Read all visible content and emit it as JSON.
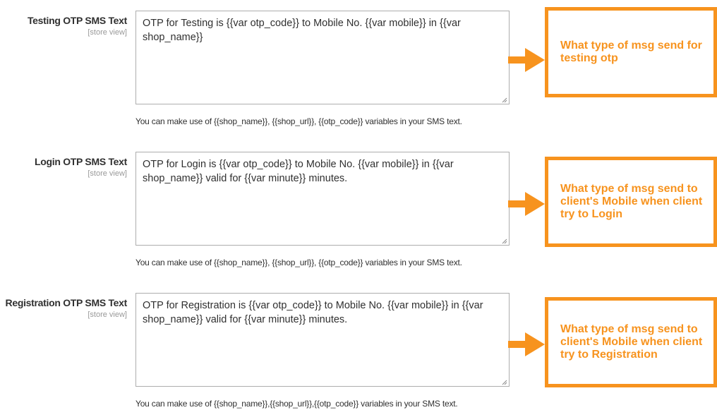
{
  "sections": [
    {
      "label": "Testing OTP SMS Text",
      "scope": "[store view]",
      "value": "OTP for Testing is {{var otp_code}} to Mobile No. {{var mobile}} in {{var shop_name}}",
      "note": "You can make use of {{shop_name}}, {{shop_url}}, {{otp_code}} variables in your SMS text.",
      "callout": "What type of msg send for testing otp"
    },
    {
      "label": "Login OTP SMS Text",
      "scope": "[store view]",
      "value": "OTP for Login is {{var otp_code}} to Mobile No. {{var mobile}} in {{var shop_name}} valid for {{var minute}} minutes.",
      "note": "You can make use of {{shop_name}}, {{shop_url}}, {{otp_code}} variables in your SMS text.",
      "callout": "What type of msg send to client's Mobile when client try to Login"
    },
    {
      "label": "Registration OTP SMS Text",
      "scope": "[store view]",
      "value": "OTP for Registration is {{var otp_code}} to Mobile No. {{var mobile}} in {{var shop_name}} valid for {{var minute}} minutes.",
      "note": "You can make use of {{shop_name}},{{shop_url}},{{otp_code}} variables in your SMS text.",
      "callout": "What type of msg send to client's Mobile when client try to Registration"
    }
  ],
  "colors": {
    "accent": "#f7931e",
    "border": "#adadad",
    "text": "#303030",
    "scope": "#999999"
  },
  "icons": {
    "arrow": "arrow-right-icon",
    "grip": "resize-grip-icon"
  }
}
